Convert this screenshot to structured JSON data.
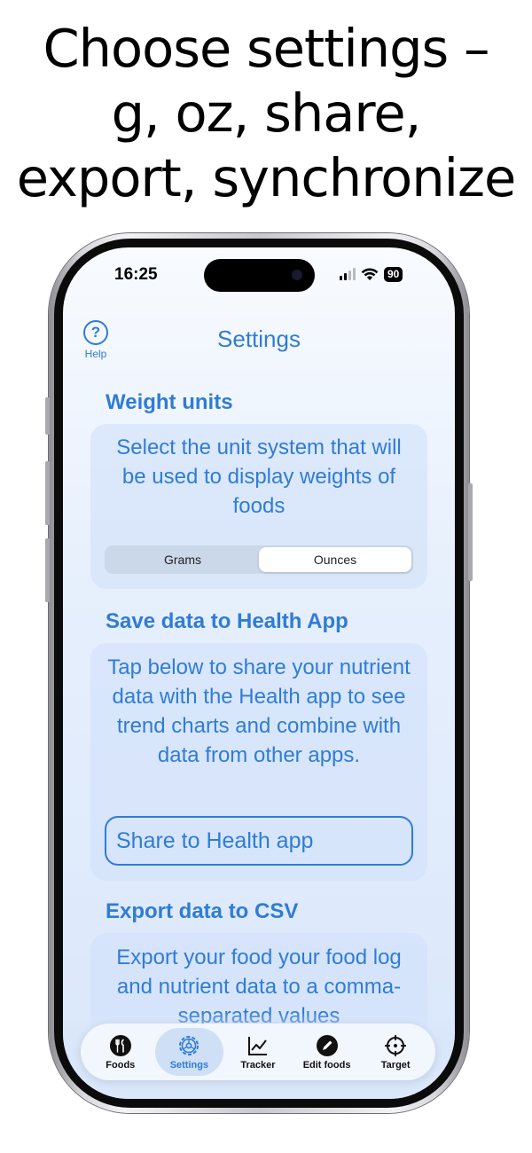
{
  "headline": {
    "line1": "Choose settings –",
    "line2": "g, oz, share,",
    "line3": "export, synchronize"
  },
  "status_bar": {
    "time": "16:25",
    "battery": "90"
  },
  "header": {
    "help_label": "Help",
    "help_glyph": "?",
    "title": "Settings"
  },
  "weight_units": {
    "title": "Weight units",
    "description": "Select the unit system that will be used to display weights of foods",
    "options": [
      "Grams",
      "Ounces"
    ],
    "selected": "Ounces"
  },
  "health": {
    "title": "Save data to Health App",
    "description": "Tap below to share your nutrient data with the Health app to see trend charts and combine with data from other apps.",
    "button_label": "Share to Health app"
  },
  "export": {
    "title": "Export data to CSV",
    "description": "Export your food your food log and nutrient data to a comma-separated values"
  },
  "tabbar": {
    "tabs": [
      {
        "label": "Foods",
        "icon": "fork-knife-icon"
      },
      {
        "label": "Settings",
        "icon": "gear-icon"
      },
      {
        "label": "Tracker",
        "icon": "chart-line-icon"
      },
      {
        "label": "Edit foods",
        "icon": "pencil-icon"
      },
      {
        "label": "Target",
        "icon": "crosshair-icon"
      }
    ],
    "active": "Settings"
  },
  "colors": {
    "accent": "#2f7cd6",
    "card": "#d2e2fa"
  }
}
